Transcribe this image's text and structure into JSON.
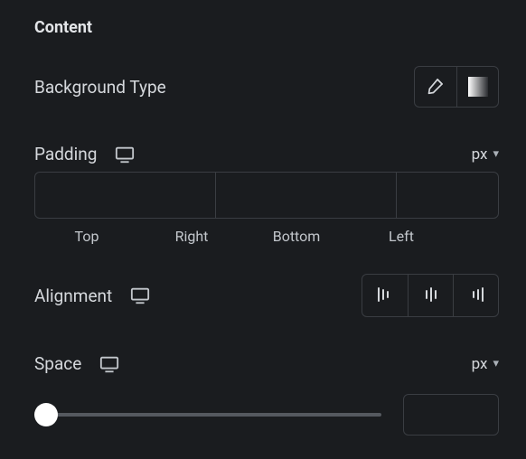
{
  "section": {
    "title": "Content"
  },
  "background": {
    "label": "Background Type",
    "icons": {
      "brush": "brush-icon",
      "gradient": "gradient-icon"
    }
  },
  "padding": {
    "label": "Padding",
    "unit": "px",
    "sides": {
      "top": "",
      "right": "",
      "bottom": "",
      "left": ""
    },
    "labels": {
      "top": "Top",
      "right": "Right",
      "bottom": "Bottom",
      "left": "Left"
    },
    "linked": true
  },
  "alignment": {
    "label": "Alignment",
    "options": [
      "align-left",
      "align-center",
      "align-right"
    ]
  },
  "space": {
    "label": "Space",
    "unit": "px",
    "value": ""
  }
}
